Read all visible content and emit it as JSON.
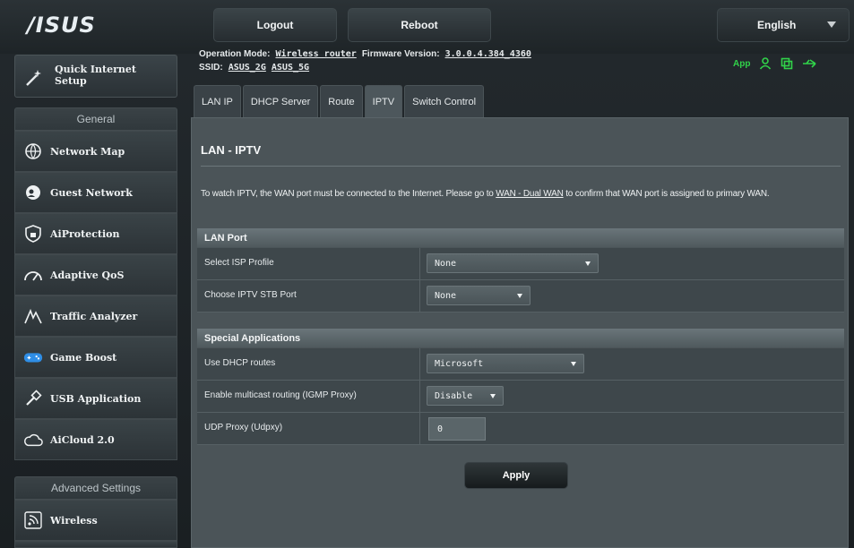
{
  "header": {
    "logo": "/ISUS",
    "logout_label": "Logout",
    "reboot_label": "Reboot",
    "language": "English"
  },
  "info": {
    "operation_mode_label": "Operation Mode:",
    "operation_mode_value": "Wireless router",
    "firmware_label": "Firmware Version:",
    "firmware_value": "3.0.0.4.384_4360",
    "ssid_label": "SSID:",
    "ssid_2g": "ASUS_2G",
    "ssid_5g": "ASUS_5G",
    "app_label": "App"
  },
  "tabs": [
    "LAN IP",
    "DHCP Server",
    "Route",
    "IPTV",
    "Switch Control"
  ],
  "sidebar": {
    "quick_setup": "Quick Internet Setup",
    "quick_setup_line1": "Quick Internet",
    "quick_setup_line2": "Setup",
    "general_header": "General",
    "items": [
      {
        "label": "Network Map",
        "icon": "network-map-icon"
      },
      {
        "label": "Guest Network",
        "icon": "guest-network-icon"
      },
      {
        "label": "AiProtection",
        "icon": "lock-icon"
      },
      {
        "label": "Adaptive QoS",
        "icon": "gauge-icon"
      },
      {
        "label": "Traffic Analyzer",
        "icon": "traffic-icon"
      },
      {
        "label": "Game Boost",
        "icon": "gamepad-icon"
      },
      {
        "label": "USB Application",
        "icon": "usb-icon"
      },
      {
        "label": "AiCloud 2.0",
        "icon": "cloud-icon"
      }
    ],
    "advanced_header": "Advanced Settings",
    "advanced_items": [
      {
        "label": "Wireless",
        "icon": "wireless-icon"
      }
    ]
  },
  "main": {
    "title": "LAN - IPTV",
    "desc_part1": "To watch IPTV, the WAN port must be connected to the Internet. Please go to ",
    "desc_link": "WAN - Dual WAN",
    "desc_part2": " to confirm that WAN port is assigned to primary WAN.",
    "section_lan_port": "LAN Port",
    "isp_profile_label": "Select ISP Profile",
    "isp_profile_value": "None",
    "stb_port_label": "Choose IPTV STB Port",
    "stb_port_value": "None",
    "section_special": "Special Applications",
    "dhcp_routes_label": "Use DHCP routes",
    "dhcp_routes_value": "Microsoft",
    "multicast_label": "Enable multicast routing (IGMP Proxy)",
    "multicast_value": "Disable",
    "udp_proxy_label": "UDP Proxy (Udpxy)",
    "udp_proxy_value": "0",
    "apply_label": "Apply"
  }
}
